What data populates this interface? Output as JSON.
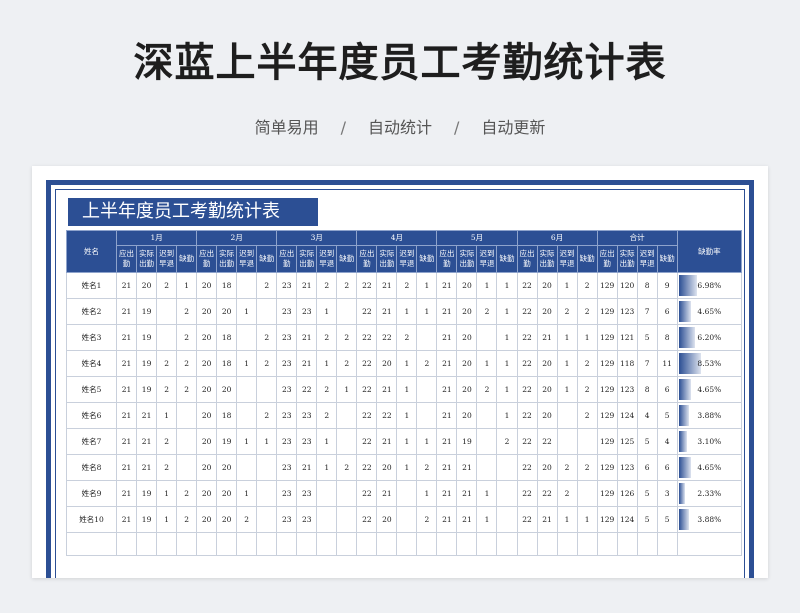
{
  "hero": {
    "title": "深蓝上半年度员工考勤统计表",
    "tags": [
      "简单易用",
      "自动统计",
      "自动更新"
    ],
    "separator": "/"
  },
  "sheet": {
    "title": "上半年度员工考勤统计表",
    "name_header": "姓名",
    "months": [
      "1月",
      "2月",
      "3月",
      "4月",
      "5月",
      "6月"
    ],
    "total_header": "合计",
    "rate_header": "缺勤率",
    "sub_headers": [
      "应出勤",
      "实际出勤",
      "迟到早退",
      "缺勤"
    ],
    "accent_color": "#2c4f94",
    "rows": [
      {
        "name": "姓名1",
        "months": [
          [
            "21",
            "20",
            "2",
            "1"
          ],
          [
            "20",
            "18",
            "",
            "2"
          ],
          [
            "23",
            "21",
            "2",
            "2"
          ],
          [
            "22",
            "21",
            "2",
            "1"
          ],
          [
            "21",
            "20",
            "1",
            "1"
          ],
          [
            "22",
            "20",
            "1",
            "2"
          ]
        ],
        "total": [
          "129",
          "120",
          "8",
          "9"
        ],
        "rate": "6.98%",
        "rate_value": 0.0698
      },
      {
        "name": "姓名2",
        "months": [
          [
            "21",
            "19",
            "",
            "2"
          ],
          [
            "20",
            "20",
            "1",
            ""
          ],
          [
            "23",
            "23",
            "1",
            ""
          ],
          [
            "22",
            "21",
            "1",
            "1"
          ],
          [
            "21",
            "20",
            "2",
            "1"
          ],
          [
            "22",
            "20",
            "2",
            "2"
          ]
        ],
        "total": [
          "129",
          "123",
          "7",
          "6"
        ],
        "rate": "4.65%",
        "rate_value": 0.0465
      },
      {
        "name": "姓名3",
        "months": [
          [
            "21",
            "19",
            "",
            "2"
          ],
          [
            "20",
            "18",
            "",
            "2"
          ],
          [
            "23",
            "21",
            "2",
            "2"
          ],
          [
            "22",
            "22",
            "2",
            ""
          ],
          [
            "21",
            "20",
            "",
            "1"
          ],
          [
            "22",
            "21",
            "1",
            "1"
          ]
        ],
        "total": [
          "129",
          "121",
          "5",
          "8"
        ],
        "rate": "6.20%",
        "rate_value": 0.062
      },
      {
        "name": "姓名4",
        "months": [
          [
            "21",
            "19",
            "2",
            "2"
          ],
          [
            "20",
            "18",
            "1",
            "2"
          ],
          [
            "23",
            "21",
            "1",
            "2"
          ],
          [
            "22",
            "20",
            "1",
            "2"
          ],
          [
            "21",
            "20",
            "1",
            "1"
          ],
          [
            "22",
            "20",
            "1",
            "2"
          ]
        ],
        "total": [
          "129",
          "118",
          "7",
          "11"
        ],
        "rate": "8.53%",
        "rate_value": 0.0853
      },
      {
        "name": "姓名5",
        "months": [
          [
            "21",
            "19",
            "2",
            "2"
          ],
          [
            "20",
            "20",
            "",
            ""
          ],
          [
            "23",
            "22",
            "2",
            "1"
          ],
          [
            "22",
            "21",
            "1",
            ""
          ],
          [
            "21",
            "20",
            "2",
            "1"
          ],
          [
            "22",
            "20",
            "1",
            "2"
          ]
        ],
        "total": [
          "129",
          "123",
          "8",
          "6"
        ],
        "rate": "4.65%",
        "rate_value": 0.0465
      },
      {
        "name": "姓名6",
        "months": [
          [
            "21",
            "21",
            "1",
            ""
          ],
          [
            "20",
            "18",
            "",
            "2"
          ],
          [
            "23",
            "23",
            "2",
            ""
          ],
          [
            "22",
            "22",
            "1",
            ""
          ],
          [
            "21",
            "20",
            "",
            "1"
          ],
          [
            "22",
            "20",
            "",
            "2"
          ]
        ],
        "total": [
          "129",
          "124",
          "4",
          "5"
        ],
        "rate": "3.88%",
        "rate_value": 0.0388
      },
      {
        "name": "姓名7",
        "months": [
          [
            "21",
            "21",
            "2",
            ""
          ],
          [
            "20",
            "19",
            "1",
            "1"
          ],
          [
            "23",
            "23",
            "1",
            ""
          ],
          [
            "22",
            "21",
            "1",
            "1"
          ],
          [
            "21",
            "19",
            "",
            "2"
          ],
          [
            "22",
            "22",
            "",
            ""
          ]
        ],
        "total": [
          "129",
          "125",
          "5",
          "4"
        ],
        "rate": "3.10%",
        "rate_value": 0.031
      },
      {
        "name": "姓名8",
        "months": [
          [
            "21",
            "21",
            "2",
            ""
          ],
          [
            "20",
            "20",
            "",
            ""
          ],
          [
            "23",
            "21",
            "1",
            "2"
          ],
          [
            "22",
            "20",
            "1",
            "2"
          ],
          [
            "21",
            "21",
            "",
            ""
          ],
          [
            "22",
            "20",
            "2",
            "2"
          ]
        ],
        "total": [
          "129",
          "123",
          "6",
          "6"
        ],
        "rate": "4.65%",
        "rate_value": 0.0465
      },
      {
        "name": "姓名9",
        "months": [
          [
            "21",
            "19",
            "1",
            "2"
          ],
          [
            "20",
            "20",
            "1",
            ""
          ],
          [
            "23",
            "23",
            "",
            ""
          ],
          [
            "22",
            "21",
            "",
            "1"
          ],
          [
            "21",
            "21",
            "1",
            ""
          ],
          [
            "22",
            "22",
            "2",
            ""
          ]
        ],
        "total": [
          "129",
          "126",
          "5",
          "3"
        ],
        "rate": "2.33%",
        "rate_value": 0.0233
      },
      {
        "name": "姓名10",
        "months": [
          [
            "21",
            "19",
            "1",
            "2"
          ],
          [
            "20",
            "20",
            "2",
            ""
          ],
          [
            "23",
            "23",
            "",
            ""
          ],
          [
            "22",
            "20",
            "",
            "2"
          ],
          [
            "21",
            "21",
            "1",
            ""
          ],
          [
            "22",
            "21",
            "1",
            "1"
          ]
        ],
        "total": [
          "129",
          "124",
          "5",
          "5"
        ],
        "rate": "3.88%",
        "rate_value": 0.0388
      }
    ]
  }
}
